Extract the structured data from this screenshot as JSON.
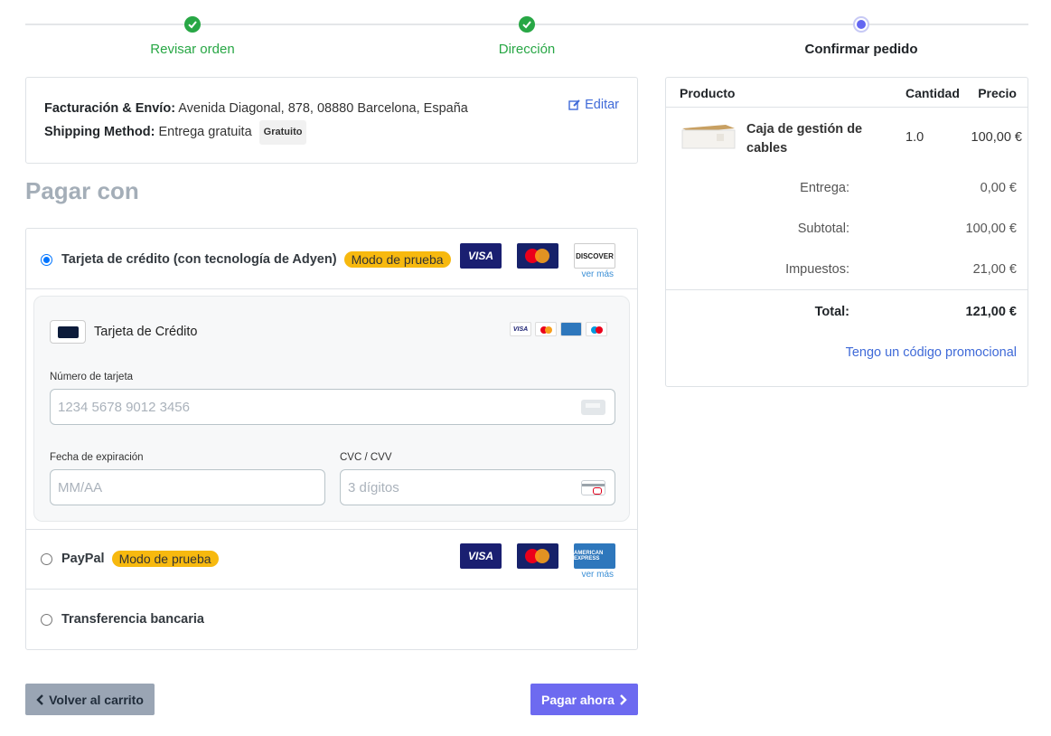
{
  "steps": [
    {
      "label": "Revisar orden",
      "state": "done"
    },
    {
      "label": "Dirección",
      "state": "done"
    },
    {
      "label": "Confirmar pedido",
      "state": "current"
    }
  ],
  "address": {
    "billing_label": "Facturación & Envío:",
    "billing_value": "Avenida Diagonal, 878, 08880 Barcelona, España",
    "shipping_label": "Shipping Method:",
    "shipping_value": "Entrega gratuita",
    "shipping_badge": "Gratuito",
    "edit_label": "Editar"
  },
  "payment": {
    "heading": "Pagar con",
    "methods": [
      {
        "label": "Tarjeta de crédito (con tecnología de Adyen)",
        "badge": "Modo de prueba",
        "selected": true,
        "logos": [
          "VISA",
          "MasterCard",
          "DISCOVER"
        ],
        "see_more": "ver más"
      },
      {
        "label": "PayPal",
        "badge": "Modo de prueba",
        "selected": false,
        "logos": [
          "VISA",
          "MasterCard",
          "AMERICAN EXPRESS"
        ],
        "see_more": "ver más"
      },
      {
        "label": "Transferencia bancaria",
        "selected": false
      }
    ],
    "card_form": {
      "title": "Tarjeta de Crédito",
      "mini_logos": [
        "VISA",
        "mastercard",
        "AMEX",
        "maestro"
      ],
      "card_number_label": "Número de tarjeta",
      "card_number_placeholder": "1234 5678 9012 3456",
      "expiry_label": "Fecha de expiración",
      "expiry_placeholder": "MM/AA",
      "cvc_label": "CVC / CVV",
      "cvc_placeholder": "3 dígitos"
    }
  },
  "buttons": {
    "back": "Volver al carrito",
    "pay": "Pagar ahora"
  },
  "summary": {
    "headers": {
      "product": "Producto",
      "qty": "Cantidad",
      "price": "Precio"
    },
    "item": {
      "name": "Caja de gestión de cables",
      "qty": "1.0",
      "price": "100,00 €"
    },
    "rows": [
      {
        "label": "Entrega:",
        "value": "0,00 €"
      },
      {
        "label": "Subtotal:",
        "value": "100,00 €"
      },
      {
        "label": "Impuestos:",
        "value": "21,00 €"
      }
    ],
    "total_label": "Total:",
    "total_value": "121,00 €",
    "promo": "Tengo un código promocional"
  },
  "colors": {
    "success": "#28a745",
    "primary": "#6d6af0",
    "badge": "#f7b90f",
    "link": "#3f6ad8"
  }
}
